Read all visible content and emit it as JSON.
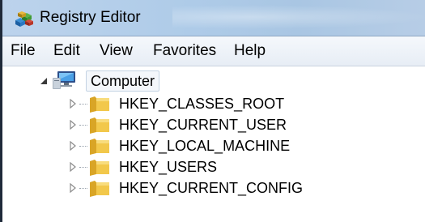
{
  "window": {
    "title": "Registry Editor",
    "icon": "registry-cubes-icon"
  },
  "menubar": {
    "items": [
      "File",
      "Edit",
      "View",
      "Favorites",
      "Help"
    ]
  },
  "tree": {
    "root": {
      "label": "Computer",
      "icon": "computer-icon",
      "expanded": true
    },
    "children": [
      {
        "label": "HKEY_CLASSES_ROOT",
        "icon": "folder-icon",
        "expanded": false
      },
      {
        "label": "HKEY_CURRENT_USER",
        "icon": "folder-icon",
        "expanded": false
      },
      {
        "label": "HKEY_LOCAL_MACHINE",
        "icon": "folder-icon",
        "expanded": false
      },
      {
        "label": "HKEY_USERS",
        "icon": "folder-icon",
        "expanded": false
      },
      {
        "label": "HKEY_CURRENT_CONFIG",
        "icon": "folder-icon",
        "expanded": false
      }
    ]
  },
  "colors": {
    "title_bar": "#aecbe8",
    "menu_bar": "#eef2f8",
    "folder": "#f2c84b",
    "selection_box": "#c4d3e3"
  }
}
